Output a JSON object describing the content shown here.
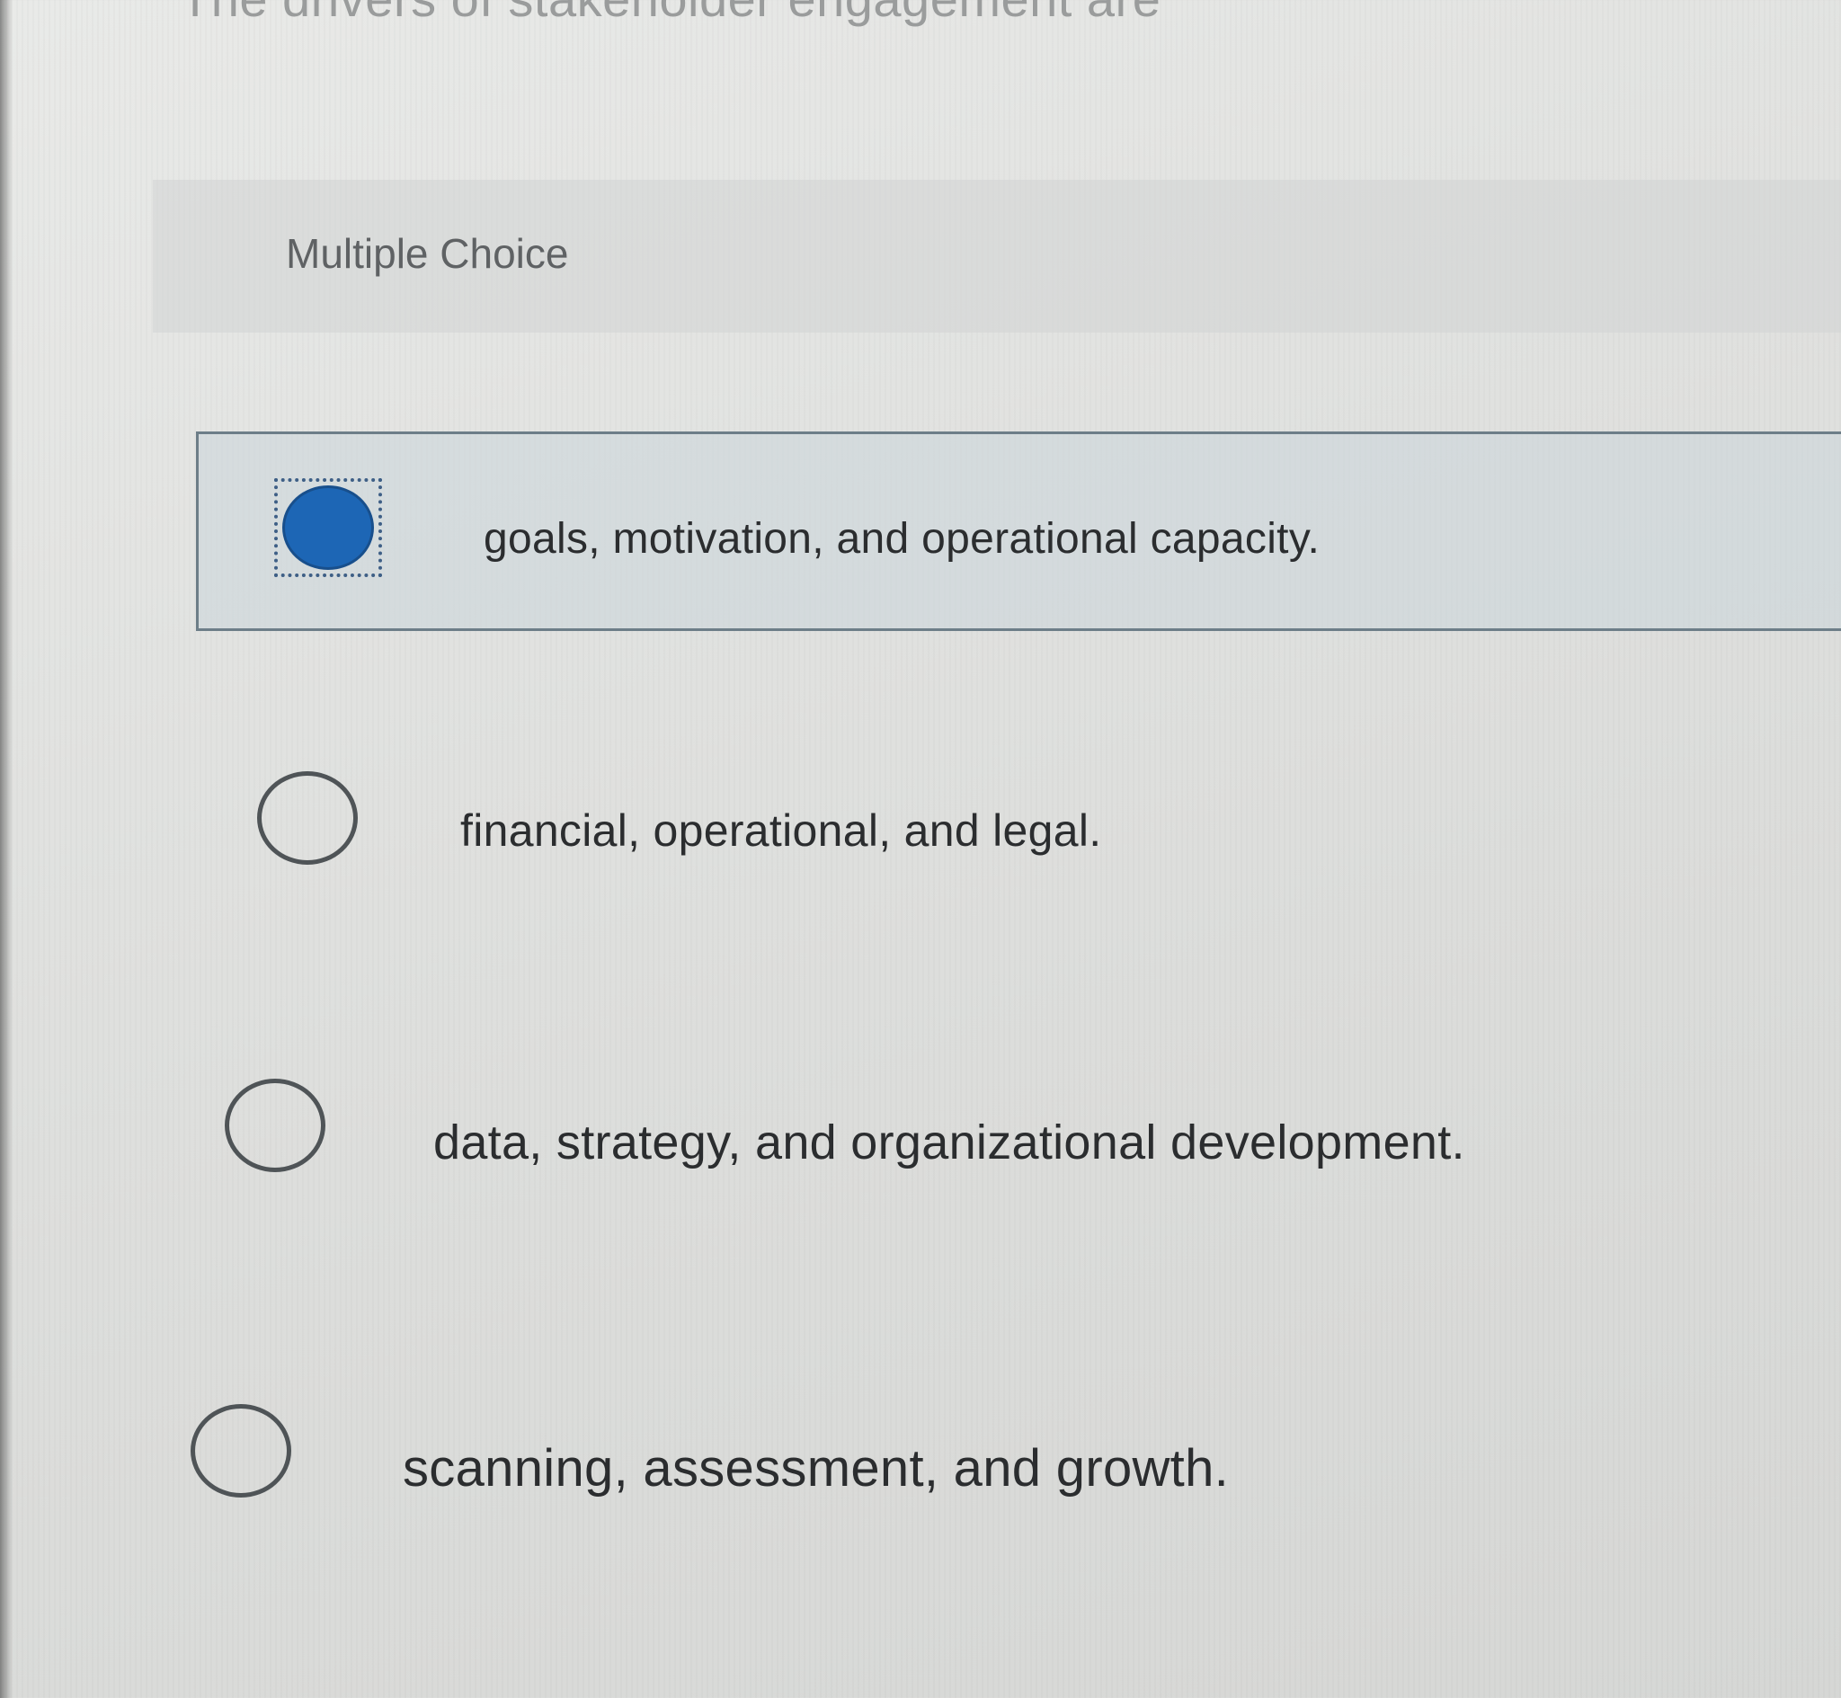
{
  "question": {
    "prompt_partial": "The drivers of stakeholder engagement are"
  },
  "section": {
    "label": "Multiple Choice"
  },
  "options": [
    {
      "label": "goals, motivation, and operational capacity.",
      "selected": true
    },
    {
      "label": "financial, operational, and legal.",
      "selected": false
    },
    {
      "label": "data, strategy, and organizational development.",
      "selected": false
    },
    {
      "label": "scanning, assessment, and growth.",
      "selected": false
    }
  ],
  "colors": {
    "selected_radio": "#1d66b5",
    "selected_row_border": "#6d7e88",
    "text": "#2b2d2f",
    "header_text": "#5f6264"
  }
}
